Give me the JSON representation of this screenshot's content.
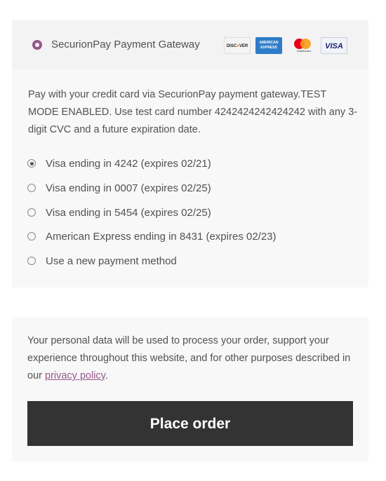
{
  "gateway": {
    "title": "SecurionPay Payment Gateway",
    "selected": true,
    "accent_color": "#96588a",
    "card_logos": [
      {
        "name": "discover-logo",
        "text": "DISCOVER"
      },
      {
        "name": "amex-logo",
        "text": "AMERICAN EXPRESS"
      },
      {
        "name": "mastercard-logo",
        "text": "mastercard"
      },
      {
        "name": "visa-logo",
        "text": "VISA"
      }
    ],
    "description": "Pay with your credit card via SecurionPay payment gateway.TEST MODE ENABLED. Use test card number 4242424242424242 with any 3-digit CVC and a future expiration date."
  },
  "saved_methods": [
    {
      "label": "Visa ending in 4242 (expires 02/21)",
      "selected": true
    },
    {
      "label": "Visa ending in 0007 (expires 02/25)",
      "selected": false
    },
    {
      "label": "Visa ending in 5454 (expires 02/25)",
      "selected": false
    },
    {
      "label": "American Express ending in 8431 (expires 02/23)",
      "selected": false
    },
    {
      "label": "Use a new payment method",
      "selected": false
    }
  ],
  "privacy": {
    "text_before": "Your personal data will be used to process your order, support your experience throughout this website, and for other purposes described in our ",
    "link_text": "privacy policy",
    "text_after": "."
  },
  "place_order": {
    "label": "Place order",
    "bg_color": "#333333"
  }
}
